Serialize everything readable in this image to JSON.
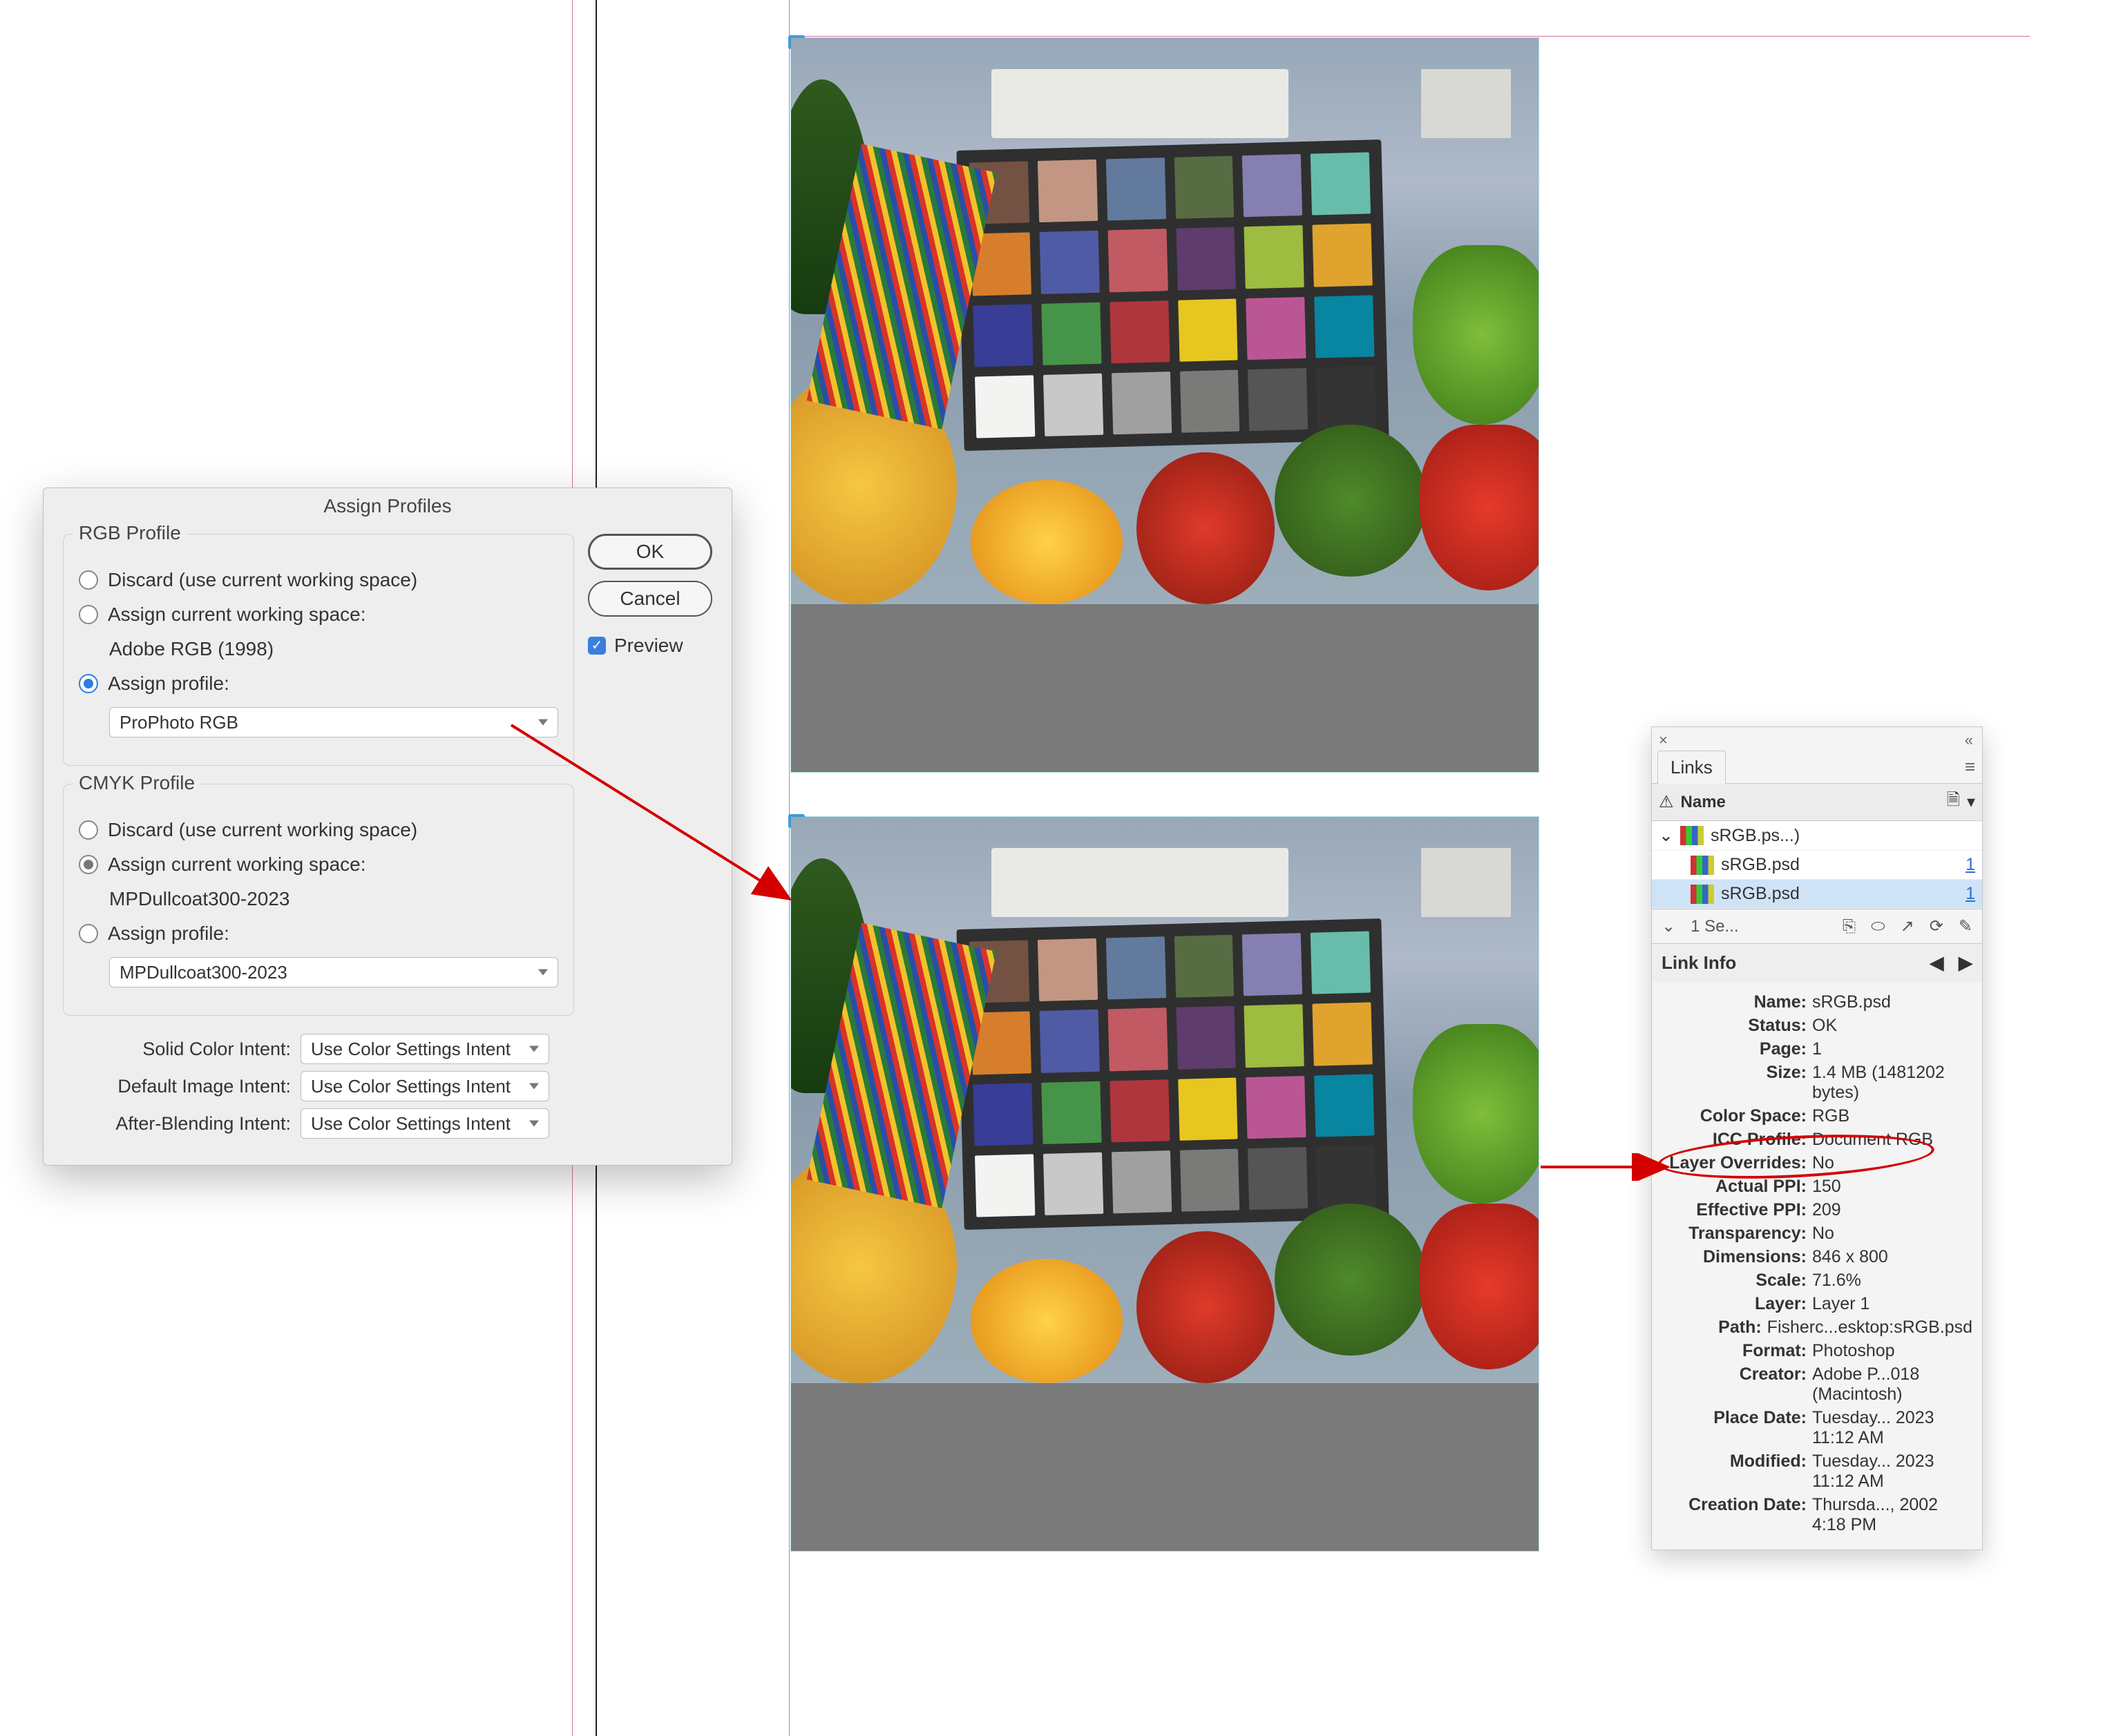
{
  "assign_profiles": {
    "title": "Assign Profiles",
    "rgb": {
      "group_label": "RGB Profile",
      "discard_label": "Discard (use current working space)",
      "current_label": "Assign current working space:",
      "current_profile": "Adobe RGB (1998)",
      "assign_label": "Assign profile:",
      "profile_value": "ProPhoto RGB",
      "selected": "assign"
    },
    "cmyk": {
      "group_label": "CMYK Profile",
      "discard_label": "Discard (use current working space)",
      "current_label": "Assign current working space:",
      "current_profile": "MPDullcoat300-2023",
      "assign_label": "Assign profile:",
      "profile_value": "MPDullcoat300-2023",
      "selected": "current"
    },
    "intents": {
      "solid_label": "Solid Color Intent:",
      "solid_value": "Use Color Settings Intent",
      "default_label": "Default Image Intent:",
      "default_value": "Use Color Settings Intent",
      "after_label": "After-Blending Intent:",
      "after_value": "Use Color Settings Intent"
    },
    "buttons": {
      "ok": "OK",
      "cancel": "Cancel",
      "preview": "Preview"
    }
  },
  "links_panel": {
    "title": "Links",
    "columns": {
      "name": "Name"
    },
    "items": [
      {
        "label": "sRGB.ps...)",
        "page": ""
      },
      {
        "label": "sRGB.psd",
        "page": "1"
      },
      {
        "label": "sRGB.psd",
        "page": "1",
        "selected": true
      }
    ],
    "selection_summary": "1 Se...",
    "info_header": "Link Info",
    "info": [
      {
        "k": "Name:",
        "v": "sRGB.psd"
      },
      {
        "k": "Status:",
        "v": "OK"
      },
      {
        "k": "Page:",
        "v": "1"
      },
      {
        "k": "Size:",
        "v": "1.4 MB (1481202 bytes)"
      },
      {
        "k": "Color Space:",
        "v": "RGB"
      },
      {
        "k": "ICC Profile:",
        "v": "Document RGB",
        "highlight": true
      },
      {
        "k": "Layer Overrides:",
        "v": "No"
      },
      {
        "k": "Actual PPI:",
        "v": "150"
      },
      {
        "k": "Effective PPI:",
        "v": "209"
      },
      {
        "k": "Transparency:",
        "v": "No"
      },
      {
        "k": "Dimensions:",
        "v": "846 x 800"
      },
      {
        "k": "Scale:",
        "v": "71.6%"
      },
      {
        "k": "Layer:",
        "v": "Layer 1"
      },
      {
        "k": "Path:",
        "v": "Fisherc...esktop:sRGB.psd"
      },
      {
        "k": "Format:",
        "v": "Photoshop"
      },
      {
        "k": "Creator:",
        "v": "Adobe P...018 (Macintosh)"
      },
      {
        "k": "Place Date:",
        "v": "Tuesday... 2023 11:12 AM"
      },
      {
        "k": "Modified:",
        "v": "Tuesday... 2023 11:12 AM"
      },
      {
        "k": "Creation Date:",
        "v": "Thursda..., 2002 4:18 PM"
      }
    ]
  },
  "checker_colors": [
    "#735244",
    "#c29682",
    "#627a9d",
    "#576c43",
    "#8580b1",
    "#67bdaa",
    "#d67e2c",
    "#505ba6",
    "#c15a63",
    "#5e3c6c",
    "#9dbc40",
    "#e0a32e",
    "#383d96",
    "#469449",
    "#af363c",
    "#e7c71f",
    "#bb5695",
    "#0885a1",
    "#f3f3f2",
    "#c8c8c8",
    "#a0a0a0",
    "#7a7a79",
    "#555555",
    "#343434"
  ]
}
